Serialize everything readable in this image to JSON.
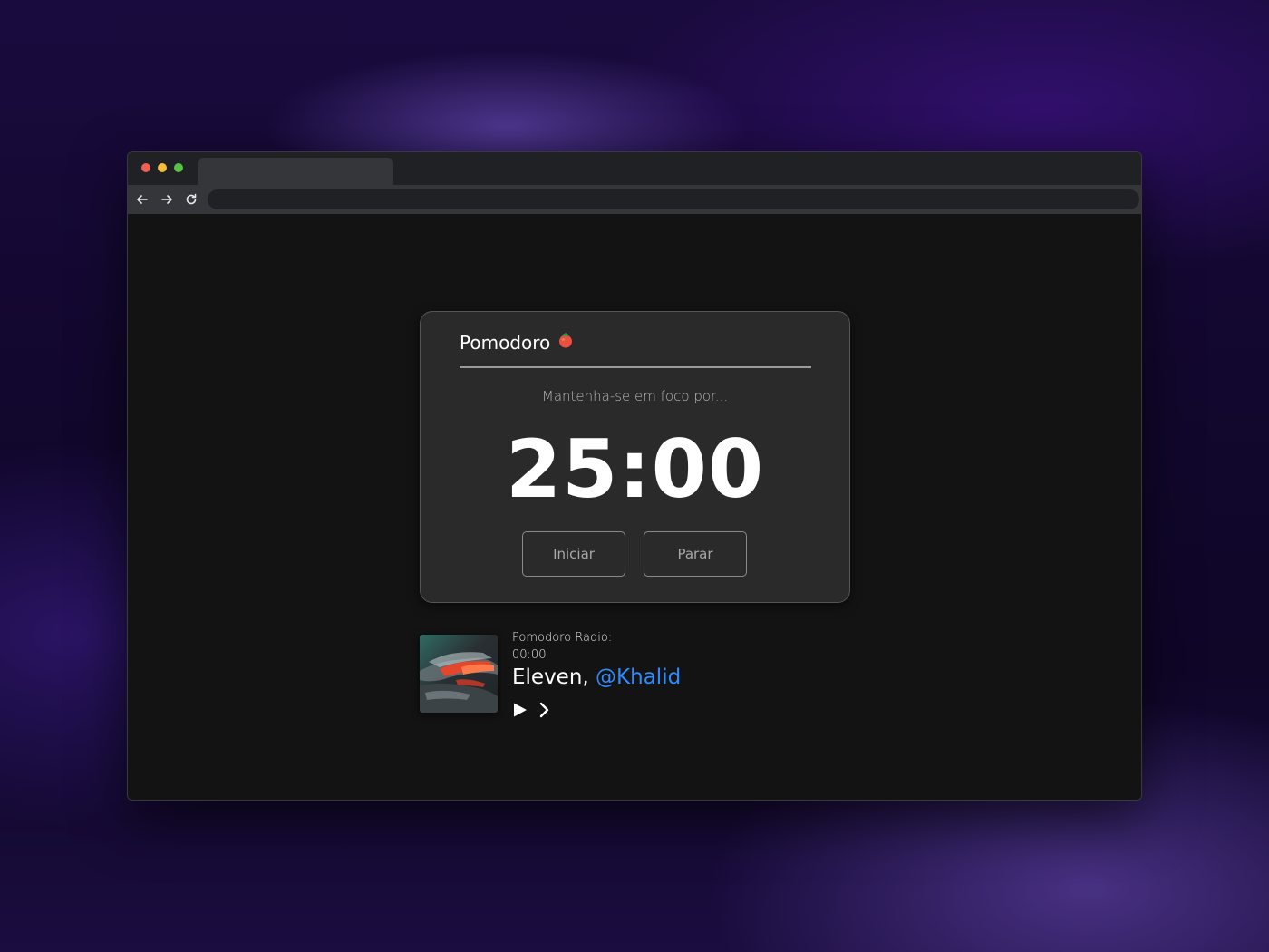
{
  "colors": {
    "accent_link": "#2e8cff",
    "card_background": "#2a2a2a",
    "page_background": "#131313",
    "traffic_red": "#ee5f55",
    "traffic_yellow": "#f5bd3e",
    "traffic_green": "#58c243"
  },
  "browser": {
    "tab_title": "",
    "url": ""
  },
  "pomodoro": {
    "title": "Pomodoro",
    "title_icon": "tomato-icon",
    "subtitle": "Mantenha-se em foco por...",
    "timer": "25:00",
    "start_label": "Iniciar",
    "stop_label": "Parar"
  },
  "player": {
    "label": "Pomodoro Radio:",
    "time": "00:00",
    "track": "Eleven,",
    "artist": "@Khalid",
    "icons": [
      "play-icon",
      "next-icon"
    ]
  }
}
